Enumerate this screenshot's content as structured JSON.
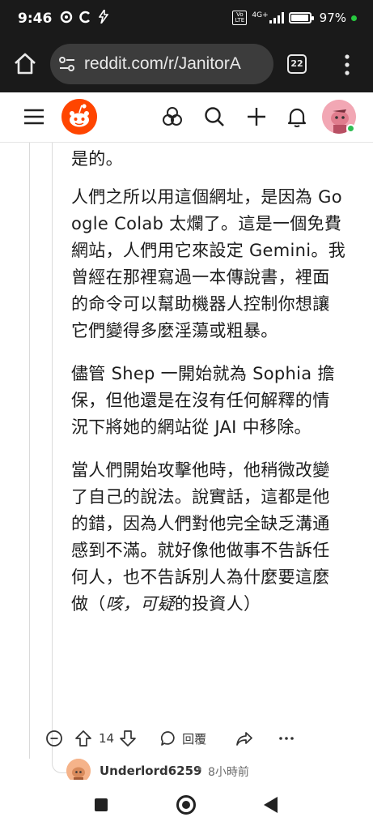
{
  "status_bar": {
    "time": "9:46",
    "notif_icons": [
      "o-icon",
      "c-icon",
      "flash-icon"
    ],
    "network_label": "4G+",
    "volte_label": "Vo LTE",
    "battery": "97%"
  },
  "browser": {
    "url": "reddit.com/r/JanitorA",
    "tab_count": "22"
  },
  "comment": {
    "paragraphs": [
      "是的。",
      "人們之所以用這個網址，是因為 Google Colab 太爛了。這是一個免費網站，人們用它來設定 Gemini。我曾經在那裡寫過一本傳說書，裡面的命令可以幫助機器人控制你想讓它們變得多麼淫蕩或粗暴。",
      "儘管 Shep 一開始就為 Sophia 擔保，但他還是在沒有任何解釋的情況下將她的網站從 JAI 中移除。"
    ],
    "last_paragraph": {
      "before": "當人們開始攻擊他時，他稍微改變了自己的說法。說實話，這都是他的錯，因為人們對他完全缺乏溝通感到不滿。就好像他做事不告訴任何人，也不告訴別人為什麼要這麼做（",
      "italic": "咳，可疑",
      "after": "的投資人）"
    },
    "votes": "14",
    "reply_label": "回覆"
  },
  "reply": {
    "username": "Underlord6259",
    "separator": "•",
    "time": "8小時前"
  },
  "colors": {
    "reddit_orange": "#ff4500",
    "online_green": "#2fbd53"
  }
}
